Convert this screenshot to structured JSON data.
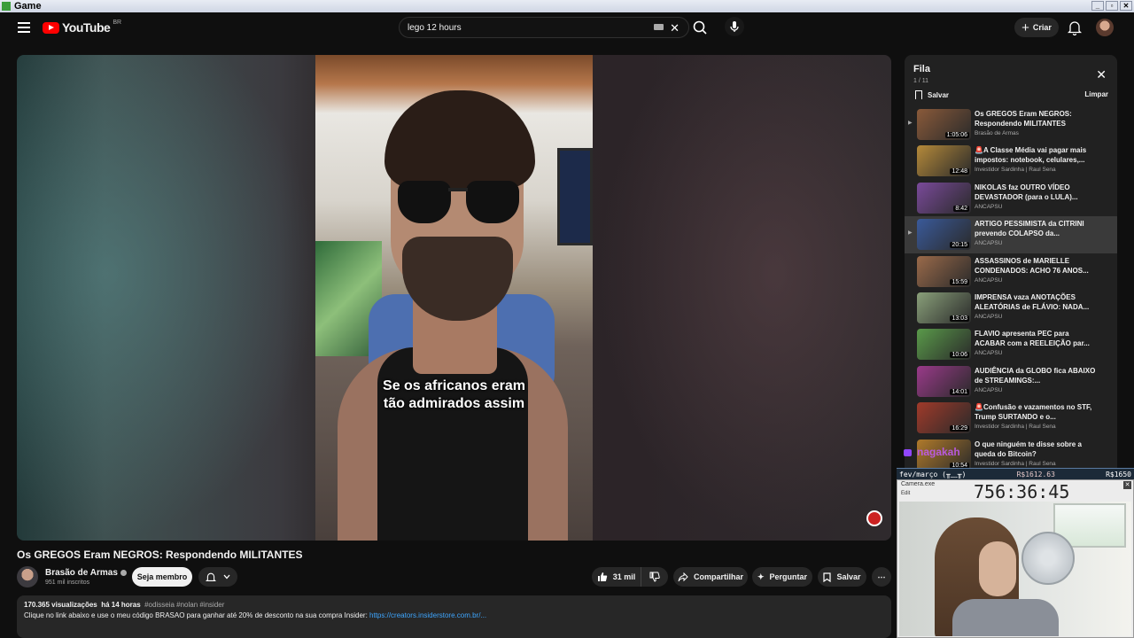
{
  "window": {
    "title": "Game",
    "controls": [
      "_",
      "▫",
      "✕"
    ]
  },
  "header": {
    "logo_text": "YouTube",
    "country_code": "BR",
    "search_value": "lego 12 hours",
    "create_label": "Criar"
  },
  "video": {
    "caption_line1": "Se os africanos eram",
    "caption_line2": "tão admirados assim",
    "title": "Os GREGOS Eram NEGROS: Respondendo MILITANTES"
  },
  "channel": {
    "name": "Brasão de Armas",
    "subscribers": "951 mil inscritos",
    "member_label": "Seja membro"
  },
  "actions": {
    "likes": "31 mil",
    "share": "Compartilhar",
    "ask": "Perguntar",
    "save": "Salvar"
  },
  "description": {
    "views": "170.365 visualizações",
    "date": "há 14 horas",
    "tags": "#odisseia #nolan #insider",
    "text": "Clique no link abaixo e use o meu código BRASAO para ganhar até 20% de desconto na sua compra Insider:",
    "link": "https://creators.insiderstore.com.br/..."
  },
  "queue": {
    "title": "Fila",
    "count": "1 / 11",
    "save_label": "Salvar",
    "clear_label": "Limpar",
    "items": [
      {
        "title": "Os GREGOS Eram NEGROS: Respondendo MILITANTES",
        "channel": "Brasão de Armas",
        "duration": "1:05:06",
        "thumb": "#8a5a3a"
      },
      {
        "title": "🚨A Classe Média vai pagar mais impostos: notebook, celulares,...",
        "channel": "Investidor Sardinha | Raul Sena",
        "duration": "12:48",
        "thumb": "#b58a3a"
      },
      {
        "title": "NIKOLAS faz OUTRO VÍDEO DEVASTADOR (para o LULA)...",
        "channel": "ANCAPSU",
        "duration": "8:42",
        "thumb": "#7a4a9a"
      },
      {
        "title": "ARTIGO PESSIMISTA da CITRINI prevendo COLAPSO da...",
        "channel": "ANCAPSU",
        "duration": "20:15",
        "thumb": "#3a5a9a"
      },
      {
        "title": "ASSASSINOS de MARIELLE CONDENADOS: ACHO 76 ANOS...",
        "channel": "ANCAPSU",
        "duration": "15:59",
        "thumb": "#9a6a4a"
      },
      {
        "title": "IMPRENSA vaza ANOTAÇÕES ALEATÓRIAS de FLÁVIO: NADA...",
        "channel": "ANCAPSU",
        "duration": "13:03",
        "thumb": "#8aa07a"
      },
      {
        "title": "FLAVIO apresenta PEC para ACABAR com a REELEIÇÃO par...",
        "channel": "ANCAPSU",
        "duration": "10:06",
        "thumb": "#5a9a4a"
      },
      {
        "title": "AUDIÊNCIA da GLOBO fica ABAIXO de STREAMINGS:...",
        "channel": "ANCAPSU",
        "duration": "14:01",
        "thumb": "#9a3a8a"
      },
      {
        "title": "🚨Confusão e vazamentos no STF, Trump SURTANDO e o...",
        "channel": "Investidor Sardinha | Raul Sena",
        "duration": "16:29",
        "thumb": "#a03a2a"
      },
      {
        "title": "O que ninguém te disse sobre a queda do Bitcoin?",
        "channel": "Investidor Sardinha | Raul Sena",
        "duration": "10:54",
        "thumb": "#b07a2a"
      }
    ]
  },
  "overlay": {
    "bar_left": "fev/março (╥﹏╥)",
    "bar_mid": "R$1612.63",
    "bar_right": "R$1650",
    "app_title": "Camera.exe",
    "menu": "Edit",
    "timer": "756:36:45",
    "chat_user": "nagakah"
  }
}
